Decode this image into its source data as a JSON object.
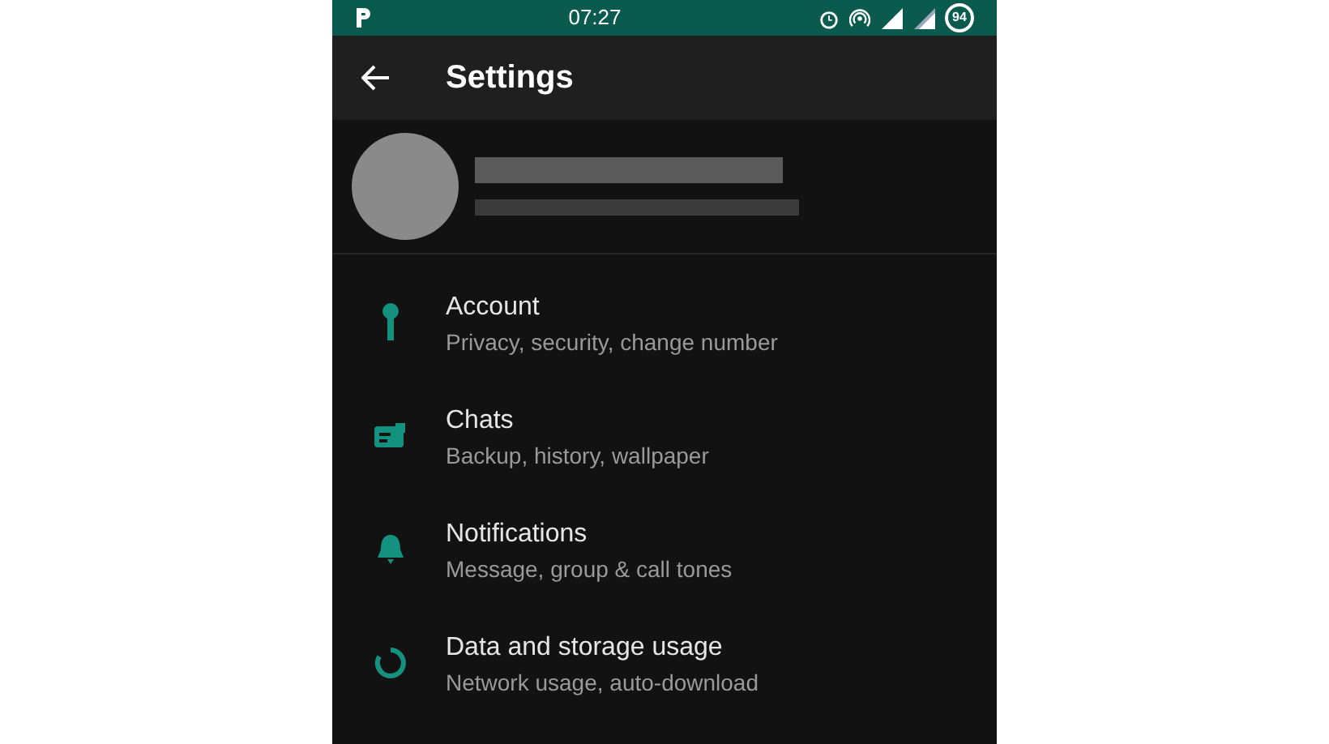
{
  "status_bar": {
    "time": "07:27",
    "battery": "94"
  },
  "header": {
    "title": "Settings"
  },
  "settings": [
    {
      "kind": "key",
      "title": "Account",
      "subtitle": "Privacy, security, change number"
    },
    {
      "kind": "chat",
      "title": "Chats",
      "subtitle": "Backup, history, wallpaper"
    },
    {
      "kind": "bell",
      "title": "Notifications",
      "subtitle": "Message, group & call tones"
    },
    {
      "kind": "data",
      "title": "Data and storage usage",
      "subtitle": "Network usage, auto-download"
    }
  ]
}
